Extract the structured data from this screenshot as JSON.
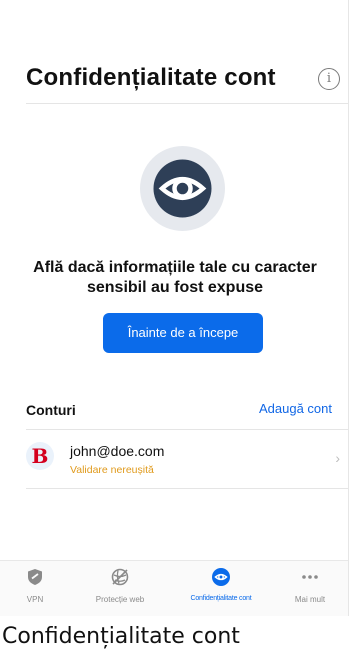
{
  "page": {
    "title": "Confidențialitate cont"
  },
  "hero": {
    "headline": "Află dacă informațiile tale cu caracter sensibil au fost expuse",
    "cta_label": "Înainte de a începe"
  },
  "accounts": {
    "title": "Conturi",
    "add_label": "Adaugă cont",
    "items": [
      {
        "logo_letter": "B",
        "email": "john@doe.com",
        "status": "Validare nereușită",
        "status_color": "#e09a1c"
      }
    ]
  },
  "tabbar": {
    "active_color": "#0b6bea",
    "items": [
      {
        "label": "VPN",
        "icon": "shield-icon",
        "active": false
      },
      {
        "label": "Protecție web",
        "icon": "web-protection-icon",
        "active": false
      },
      {
        "label": "Confidențialitate cont",
        "icon": "privacy-eye-icon",
        "active": true
      },
      {
        "label": "Mai mult",
        "icon": "more-dots-icon",
        "active": false
      }
    ]
  },
  "caption": "Confidențialitate cont"
}
